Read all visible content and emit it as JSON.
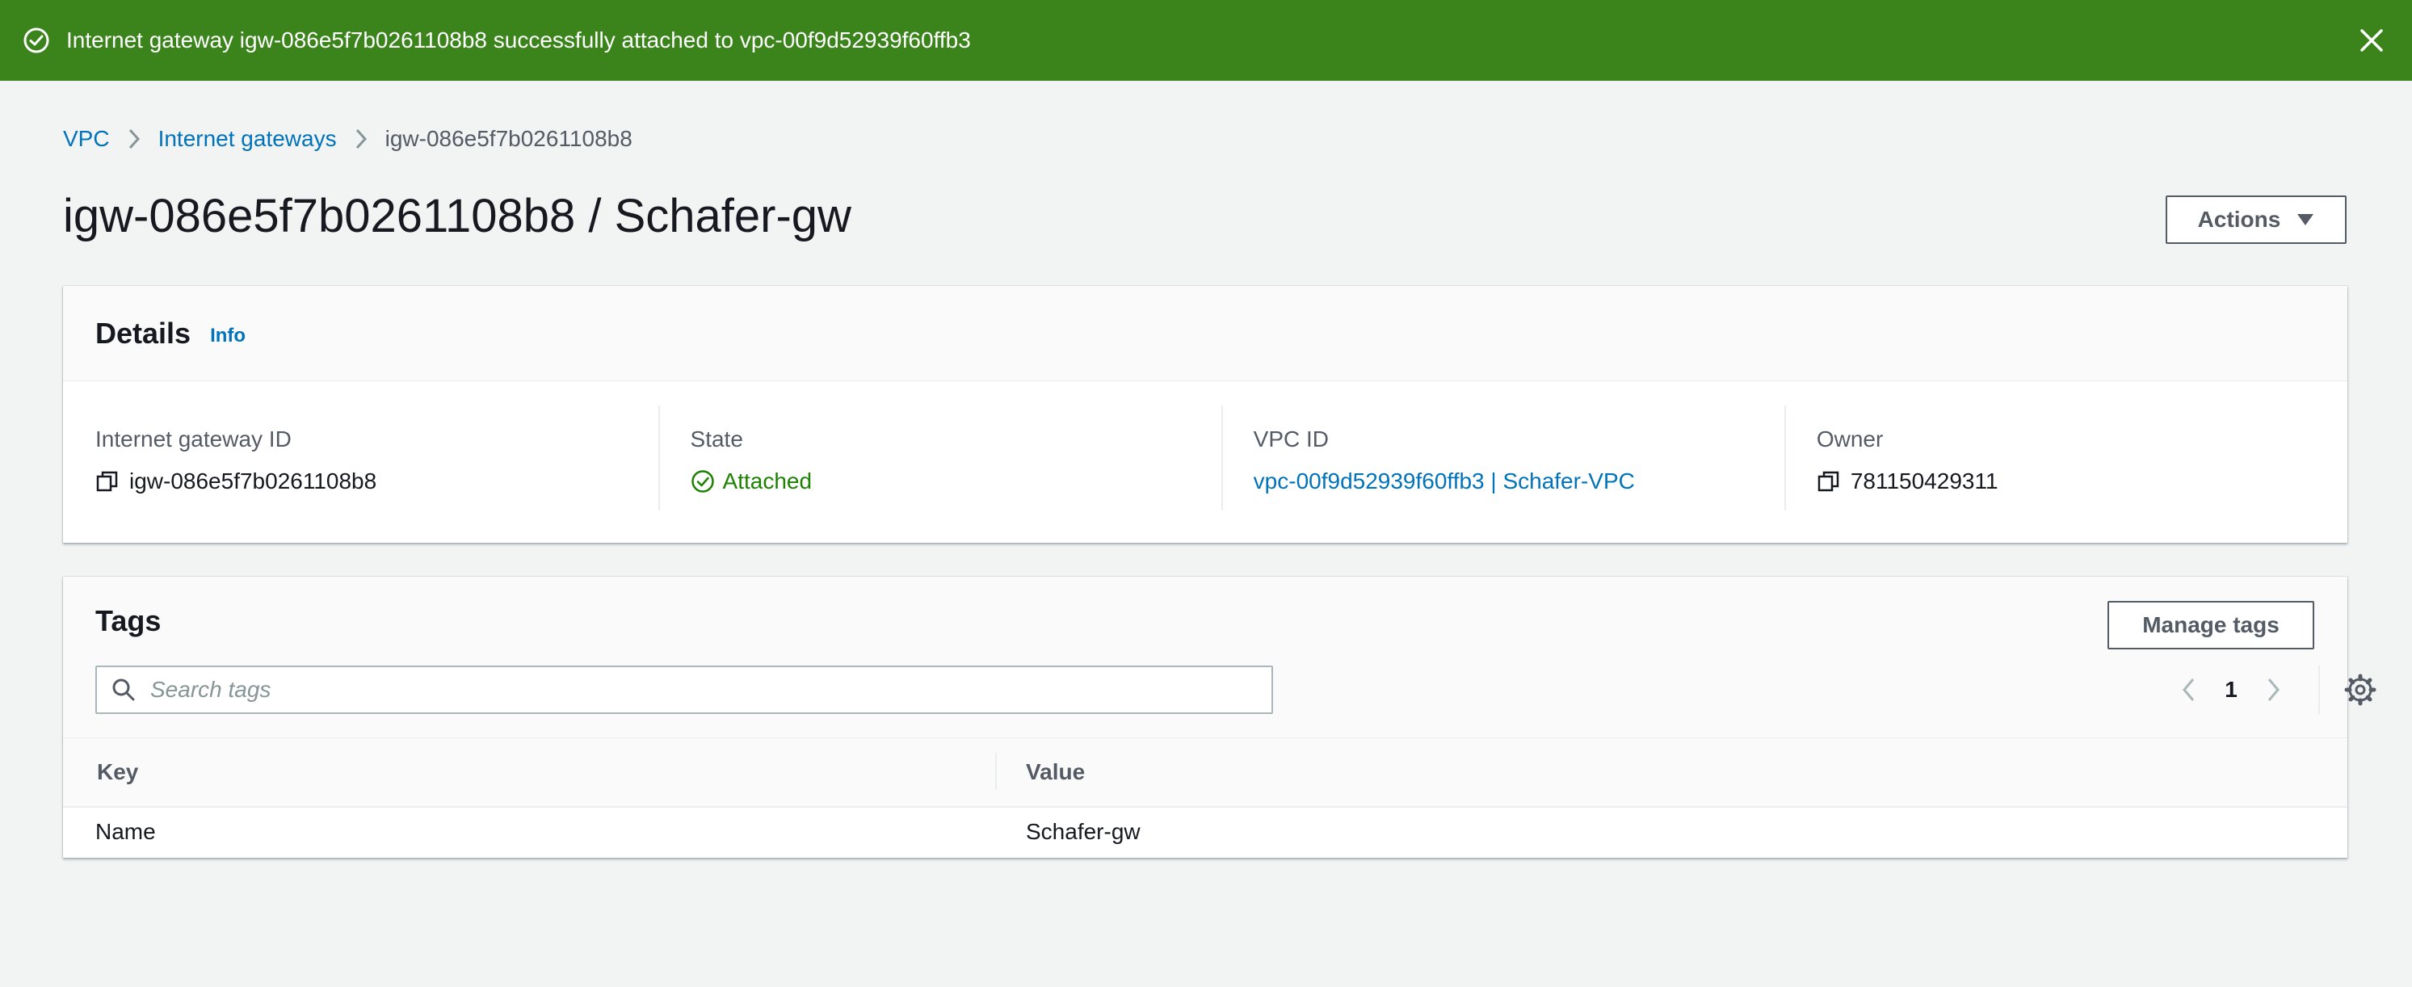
{
  "flash": {
    "message": "Internet gateway igw-086e5f7b0261108b8 successfully attached to vpc-00f9d52939f60ffb3",
    "icons": {
      "status": "check-circle-icon",
      "close": "close-icon"
    },
    "color": "#3b841c"
  },
  "breadcrumb": {
    "items": [
      "VPC",
      "Internet gateways"
    ],
    "current": "igw-086e5f7b0261108b8"
  },
  "page": {
    "title": "igw-086e5f7b0261108b8 / Schafer-gw",
    "actions_label": "Actions"
  },
  "details": {
    "title": "Details",
    "info_label": "Info",
    "fields": [
      {
        "label": "Internet gateway ID",
        "value": "igw-086e5f7b0261108b8"
      },
      {
        "label": "State",
        "value": "Attached"
      },
      {
        "label": "VPC ID",
        "value": "vpc-00f9d52939f60ffb3 | Schafer-VPC"
      },
      {
        "label": "Owner",
        "value": "781150429311"
      }
    ]
  },
  "tags": {
    "title": "Tags",
    "manage_label": "Manage tags",
    "search_placeholder": "Search tags",
    "page": "1",
    "columns": [
      "Key",
      "Value"
    ],
    "rows": [
      {
        "key": "Name",
        "value": "Schafer-gw"
      }
    ]
  },
  "colors": {
    "link": "#0073bb",
    "success": "#1d8102",
    "background": "#f2f3f3"
  }
}
